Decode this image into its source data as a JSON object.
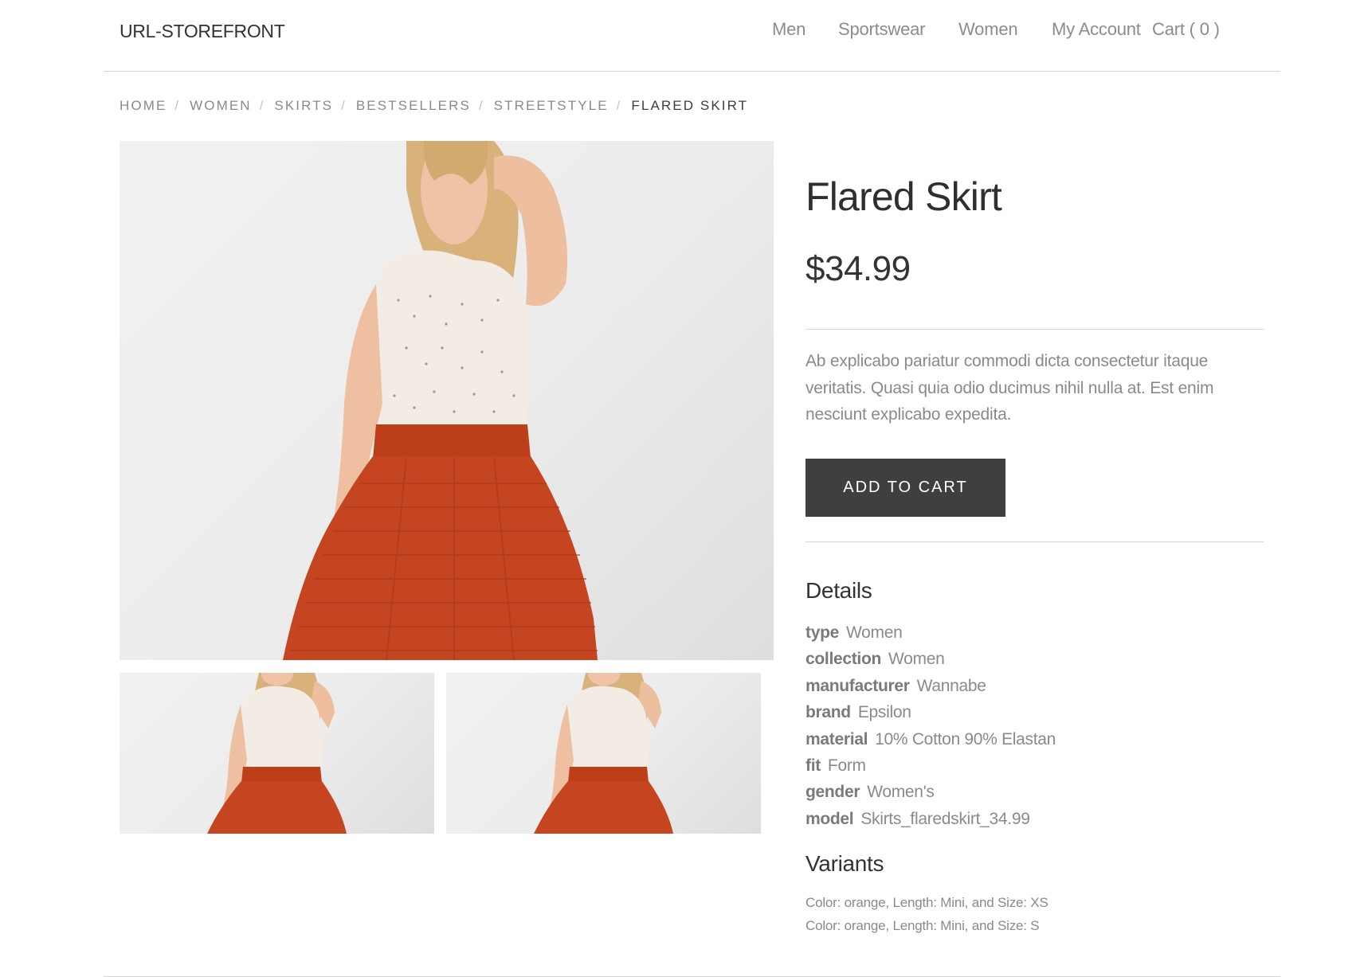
{
  "header": {
    "brand": "URL-STOREFRONT",
    "nav": [
      {
        "label": "Men"
      },
      {
        "label": "Sportswear"
      },
      {
        "label": "Women"
      },
      {
        "label": "My Account"
      },
      {
        "label": "Cart ( 0 )"
      }
    ]
  },
  "breadcrumb": [
    {
      "label": "HOME"
    },
    {
      "label": "WOMEN"
    },
    {
      "label": "SKIRTS"
    },
    {
      "label": "BESTSELLERS"
    },
    {
      "label": "STREETSTYLE"
    },
    {
      "label": "FLARED SKIRT",
      "current": true
    }
  ],
  "breadcrumb_separator": "/",
  "product": {
    "title": "Flared Skirt",
    "price": "$34.99",
    "description": "Ab explicabo pariatur commodi dicta consectetur itaque veritatis. Quasi quia odio ducimus nihil nulla at. Est enim nesciunt explicabo expedita.",
    "add_to_cart_label": "ADD TO CART",
    "details_heading": "Details",
    "details": [
      {
        "key": "type",
        "value": "Women"
      },
      {
        "key": "collection",
        "value": "Women"
      },
      {
        "key": "manufacturer",
        "value": "Wannabe"
      },
      {
        "key": "brand",
        "value": "Epsilon"
      },
      {
        "key": "material",
        "value": "10% Cotton 90% Elastan"
      },
      {
        "key": "fit",
        "value": "Form"
      },
      {
        "key": "gender",
        "value": "Women's"
      },
      {
        "key": "model",
        "value": "Skirts_flaredskirt_34.99"
      }
    ],
    "variants_heading": "Variants",
    "variants": [
      "Color: orange, Length: Mini, and Size: XS",
      "Color: orange, Length: Mini, and Size: S"
    ]
  },
  "colors": {
    "button_bg": "#3f3f3f",
    "skirt": "#c4451f",
    "text_muted": "#8a8a8a",
    "divider": "#d4d4d4"
  }
}
